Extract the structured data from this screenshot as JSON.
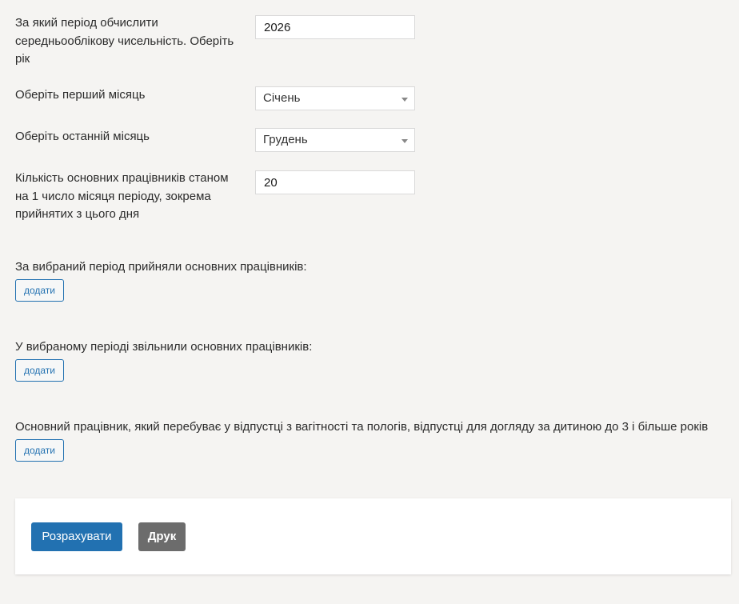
{
  "form": {
    "year": {
      "label": "За який період обчислити середньооблікову чисельність. Оберіть рік",
      "value": "2026"
    },
    "first_month": {
      "label": "Оберіть перший місяць",
      "selected": "Січень"
    },
    "last_month": {
      "label": "Оберіть останній місяць",
      "selected": "Грудень"
    },
    "employees_count": {
      "label": "Кількість основних працівників станом на 1 число місяця періоду, зокрема прийнятих з цього дня",
      "value": "20"
    },
    "hired": {
      "label": "За вибраний період прийняли основних працівників:",
      "add_label": "додати"
    },
    "dismissed": {
      "label": "У вибраному періоді звільнили основних працівників:",
      "add_label": "додати"
    },
    "on_leave": {
      "label": "Основний працівник, який перебуває у відпустці з вагітності та пологів, відпустці для догляду за дитиною до 3 і більше років",
      "add_label": "додати"
    }
  },
  "actions": {
    "calculate_label": "Розрахувати",
    "print_label": "Друк",
    "primary_color": "#2271b1",
    "secondary_color": "#6c6c6c"
  }
}
